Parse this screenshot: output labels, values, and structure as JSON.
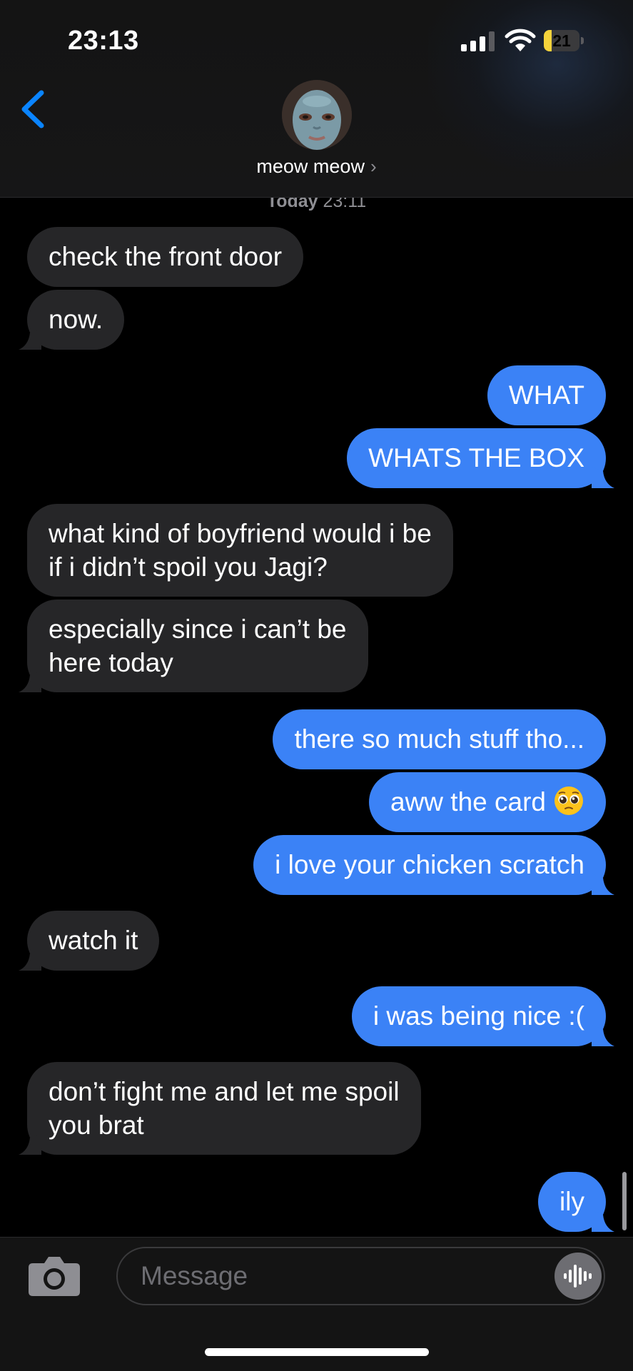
{
  "status_bar": {
    "time": "23:13",
    "battery_level": "21",
    "battery_fraction": 0.21,
    "signal_bars_active": 3,
    "signal_bars_total": 4
  },
  "header": {
    "back_icon": "chevron-left-icon",
    "contact_name": "meow meow",
    "contact_chevron": "›"
  },
  "thread": {
    "timestamp_day": "Today",
    "timestamp_time": "23:11",
    "messages": [
      {
        "direction": "received",
        "lines": [
          "check the front door"
        ]
      },
      {
        "direction": "received",
        "lines": [
          "now."
        ]
      },
      {
        "direction": "sent",
        "lines": [
          "WHAT"
        ]
      },
      {
        "direction": "sent",
        "lines": [
          "WHATS THE BOX"
        ]
      },
      {
        "direction": "received",
        "lines": [
          "what kind of boyfriend would i be",
          "if i didn’t spoil you Jagi?"
        ]
      },
      {
        "direction": "received",
        "lines": [
          "especially since i can’t be",
          "here today"
        ]
      },
      {
        "direction": "sent",
        "lines": [
          "there so much stuff tho..."
        ]
      },
      {
        "direction": "sent",
        "lines": [
          "aww the card"
        ],
        "emoji": "pleading-face-emoji"
      },
      {
        "direction": "sent",
        "lines": [
          "i love your chicken scratch"
        ]
      },
      {
        "direction": "received",
        "lines": [
          "watch it"
        ]
      },
      {
        "direction": "sent",
        "lines": [
          "i was being nice :("
        ]
      },
      {
        "direction": "received",
        "lines": [
          "don’t fight me and let me spoil",
          "you brat"
        ]
      },
      {
        "direction": "sent",
        "lines": [
          "ily"
        ]
      }
    ]
  },
  "composer": {
    "camera_icon": "camera-icon",
    "placeholder": "Message",
    "voice_icon": "waveform-icon"
  },
  "colors": {
    "received_bubble": "#262628",
    "sent_bubble": "#3b82f6",
    "accent": "#0a84ff",
    "battery_fill": "#f5d33b"
  }
}
